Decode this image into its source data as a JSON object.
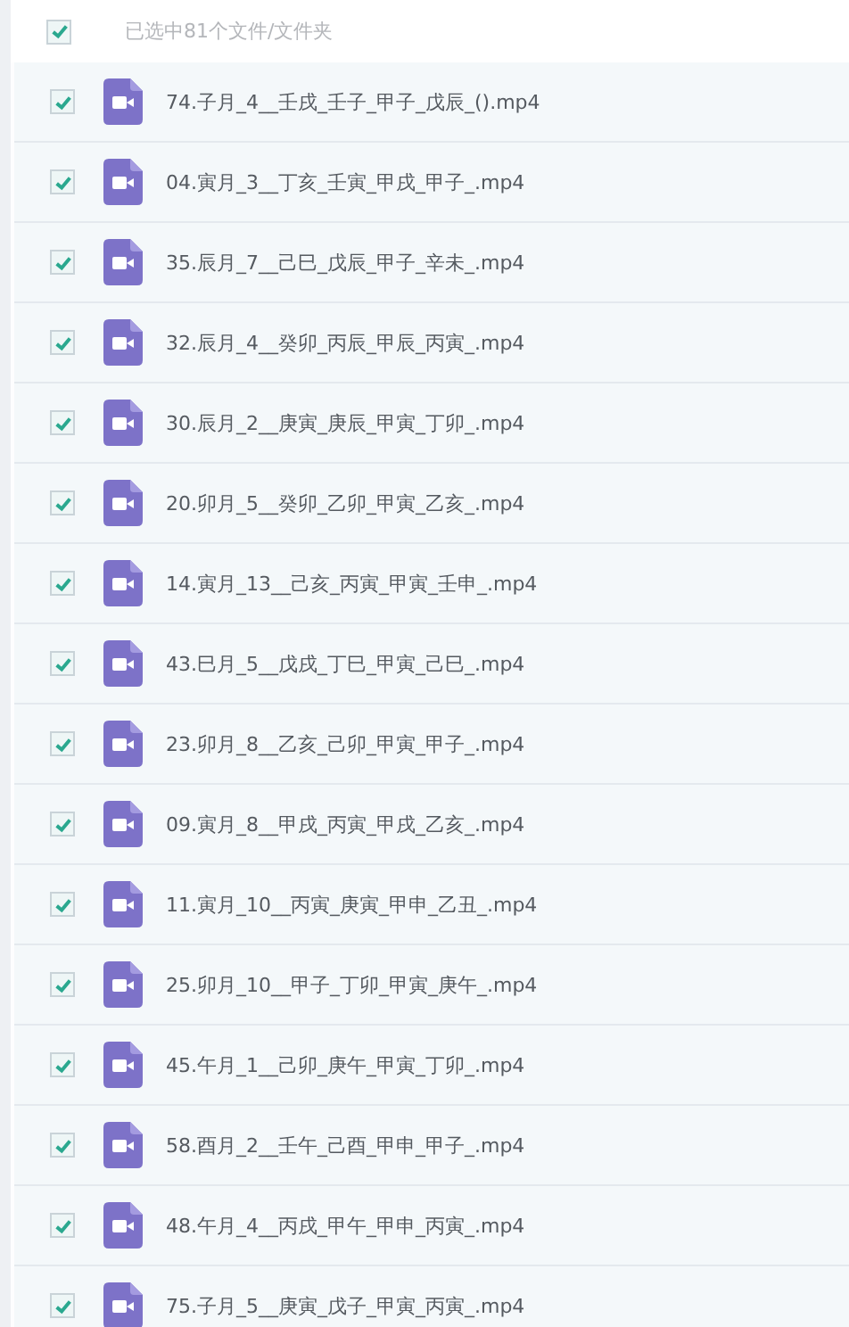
{
  "selection_bar": {
    "checked": true,
    "label": "已选中81个文件/文件夹"
  },
  "files": [
    {
      "name": "74.子月_4__壬戌_壬子_甲子_戊辰_().mp4",
      "checked": true
    },
    {
      "name": "04.寅月_3__丁亥_壬寅_甲戌_甲子_.mp4",
      "checked": true
    },
    {
      "name": "35.辰月_7__己巳_戊辰_甲子_辛未_.mp4",
      "checked": true
    },
    {
      "name": "32.辰月_4__癸卯_丙辰_甲辰_丙寅_.mp4",
      "checked": true
    },
    {
      "name": "30.辰月_2__庚寅_庚辰_甲寅_丁卯_.mp4",
      "checked": true
    },
    {
      "name": "20.卯月_5__癸卯_乙卯_甲寅_乙亥_.mp4",
      "checked": true
    },
    {
      "name": "14.寅月_13__己亥_丙寅_甲寅_壬申_.mp4",
      "checked": true
    },
    {
      "name": "43.巳月_5__戊戌_丁巳_甲寅_己巳_.mp4",
      "checked": true
    },
    {
      "name": "23.卯月_8__乙亥_己卯_甲寅_甲子_.mp4",
      "checked": true
    },
    {
      "name": "09.寅月_8__甲戌_丙寅_甲戌_乙亥_.mp4",
      "checked": true
    },
    {
      "name": "11.寅月_10__丙寅_庚寅_甲申_乙丑_.mp4",
      "checked": true
    },
    {
      "name": "25.卯月_10__甲子_丁卯_甲寅_庚午_.mp4",
      "checked": true
    },
    {
      "name": "45.午月_1__己卯_庚午_甲寅_丁卯_.mp4",
      "checked": true
    },
    {
      "name": "58.酉月_2__壬午_己酉_甲申_甲子_.mp4",
      "checked": true
    },
    {
      "name": "48.午月_4__丙戌_甲午_甲申_丙寅_.mp4",
      "checked": true
    },
    {
      "name": "75.子月_5__庚寅_戊子_甲寅_丙寅_.mp4",
      "checked": true
    }
  ]
}
